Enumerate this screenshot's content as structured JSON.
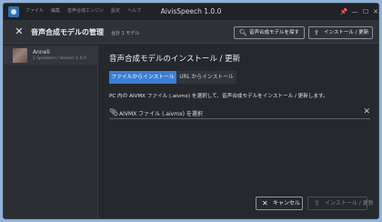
{
  "window": {
    "title": "AivisSpeech 1.0.0",
    "menu": [
      "ファイル",
      "編集",
      "音声合成エンジン",
      "設定",
      "ヘルプ"
    ]
  },
  "header": {
    "title": "音声合成モデルの管理",
    "subtitle": "合計 1 モデル",
    "find_label": "音声合成モデルを探す",
    "install_label": "インストール / 更新"
  },
  "sidebar": {
    "items": [
      {
        "name": "Anneli",
        "meta": "1 Speakers / Version 1.0.0"
      }
    ]
  },
  "main": {
    "title": "音声合成モデルのインストール / 更新",
    "tabs": [
      "ファイルからインストール",
      "URL からインストール"
    ],
    "active_tab": 0,
    "description": "PC 内の AIVMX ファイル (.aivmx) を選択して、音声合成モデルをインストール / 更新します。",
    "file_placeholder": "AIVMX ファイル (.aivmx) を選択",
    "cancel_label": "キャンセル",
    "install_label": "インストール / 更新"
  },
  "colors": {
    "accent": "#3b7ed3",
    "background": "#25282d",
    "header": "#2f3338",
    "sidebar": "#2b2e33"
  }
}
